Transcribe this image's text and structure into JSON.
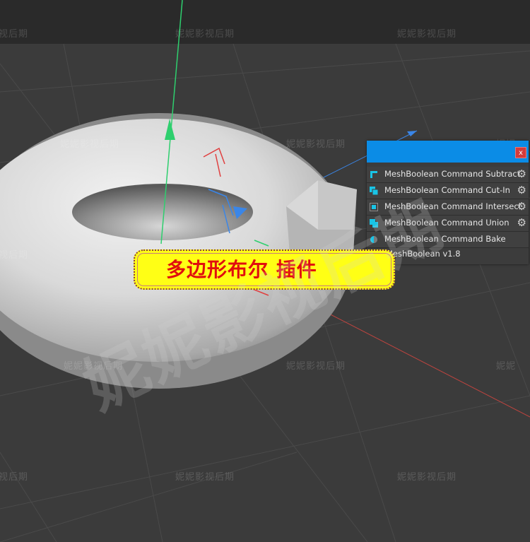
{
  "watermark": {
    "small_text": "妮妮影视后期",
    "small_text_partial_left": "视后期",
    "small_text_partial_right": "妮妮",
    "big_text": "妮妮影视后期"
  },
  "plugin_panel": {
    "close_label": "x",
    "commands": [
      {
        "label": "MeshBoolean Command Subtract",
        "icon": "subtract-icon",
        "has_settings": true
      },
      {
        "label": "MeshBoolean Command Cut-In",
        "icon": "cut-in-icon",
        "has_settings": true
      },
      {
        "label": "MeshBoolean Command Intersect",
        "icon": "intersect-icon",
        "has_settings": true
      },
      {
        "label": "MeshBoolean Command Union",
        "icon": "union-icon",
        "has_settings": true
      },
      {
        "label": "MeshBoolean Command Bake",
        "icon": "bake-icon",
        "has_settings": false
      }
    ],
    "version_label": "MeshBoolean v1.8",
    "settings_icon": "gear-icon",
    "colors": {
      "header": "#0b8ce6",
      "icon": "#19c4e6",
      "close": "#d53b3b"
    }
  },
  "banner": {
    "text": "多边形布尔 插件",
    "colors": {
      "background": "#ffff15",
      "text": "#e10e0e"
    }
  },
  "viewport": {
    "object": "torus",
    "background": "#3b3b3b",
    "axis_colors": {
      "y": "#2ecf6e",
      "x": "#e04040",
      "z": "#3a86e8"
    }
  }
}
